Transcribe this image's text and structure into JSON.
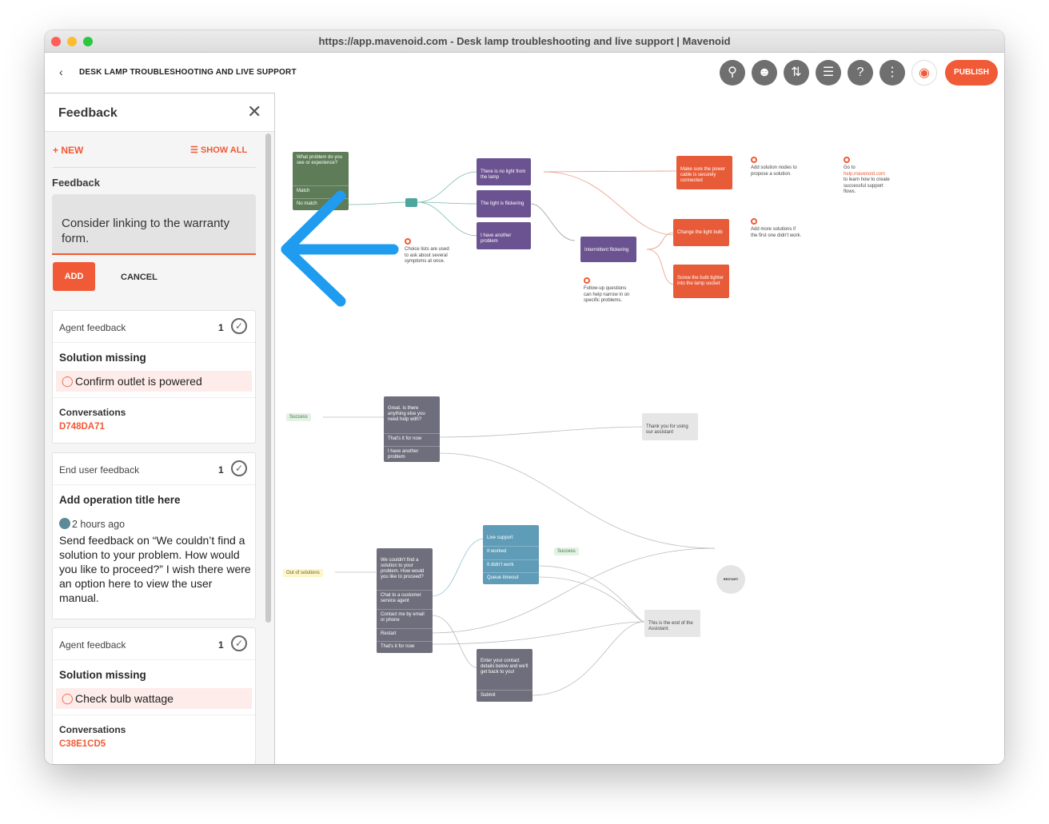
{
  "browser": {
    "title": "https://app.mavenoid.com - Desk lamp troubleshooting and live support | Mavenoid"
  },
  "topbar": {
    "back_icon": "chevron-left-icon",
    "flow_title": "DESK LAMP TROUBLESHOOTING AND LIVE SUPPORT",
    "publish_label": "PUBLISH",
    "toolbar_icons": [
      "search-icon",
      "agent-icon",
      "sort-icon",
      "sliders-icon",
      "help-icon",
      "more-icon",
      "preview-eye-icon"
    ]
  },
  "panel": {
    "title": "Feedback",
    "new_label": "+ NEW",
    "show_all_label": "SHOW ALL",
    "field_label": "Feedback",
    "input_value": "Consider linking to the warranty form.",
    "add_label": "ADD",
    "cancel_label": "CANCEL",
    "cards": [
      {
        "type": "Agent feedback",
        "count": "1",
        "operation": "Solution missing",
        "solution": "Confirm outlet is powered",
        "conversations_label": "Conversations",
        "conversation_id": "D748DA71"
      },
      {
        "type": "End user feedback",
        "count": "1",
        "operation": "Add operation title here",
        "time": "2 hours ago",
        "body": "Send feedback on “We couldn’t find a solution to your problem. How would you like to proceed?” I wish there were an option here to view the user manual."
      },
      {
        "type": "Agent feedback",
        "count": "1",
        "operation": "Solution missing",
        "solution": "Check bulb wattage",
        "conversations_label": "Conversations",
        "conversation_id": "C38E1CD5"
      }
    ]
  },
  "canvas": {
    "start_node": {
      "question": "What problem do you see or experience?",
      "rows": [
        "Match",
        "No match"
      ]
    },
    "choices": [
      "There is no light from the lamp",
      "The light is flickering",
      "I have another problem"
    ],
    "intermittent": "Intermittent flickering",
    "solutions": [
      "Make sure the power cable is securely connected",
      "Change the light bulb",
      "Screw the bulb tighter into the lamp socket"
    ],
    "notes": {
      "choice_lists": "Choice lists are used to ask about several symptoms at once.",
      "follow_up": "Follow-up questions can help narrow in on specific problems.",
      "add_solution": "Add solution nodes to propose a solution.",
      "add_more": "Add more solutions if the first one didn't work.",
      "goto_prefix": "Go to",
      "goto_link": "help.mavenoid.com",
      "goto_suffix": "to learn how to create successful support flows."
    },
    "success_tag": "Success",
    "success_node": {
      "question": "Great. Is there anything else you need help with?",
      "rows": [
        "That's it for now",
        "I have another problem"
      ]
    },
    "thank_you": "Thank you for using our assistant",
    "restart_label": "RESTART",
    "out_of_solutions_tag": "Out of solutions",
    "out_node": {
      "question": "We couldn't find a solution to your problem. How would you like to proceed?",
      "rows": [
        "Chat to a customer service agent",
        "Contact me by email or phone",
        "Restart",
        "That's it for now"
      ]
    },
    "live_node": {
      "rows": [
        "Live support",
        "It worked",
        "It didn't work",
        "Queue timeout"
      ]
    },
    "live_success_tag": "Success",
    "end_node": "This is the end of the Assistant.",
    "contact_node": {
      "question": "Enter your contact details below and we'll get back to you!",
      "rows": [
        "Submit"
      ]
    }
  },
  "colors": {
    "accent": "#f05a36",
    "arrow": "#1f9cf0",
    "panel_bg": "#f5f5f5"
  }
}
